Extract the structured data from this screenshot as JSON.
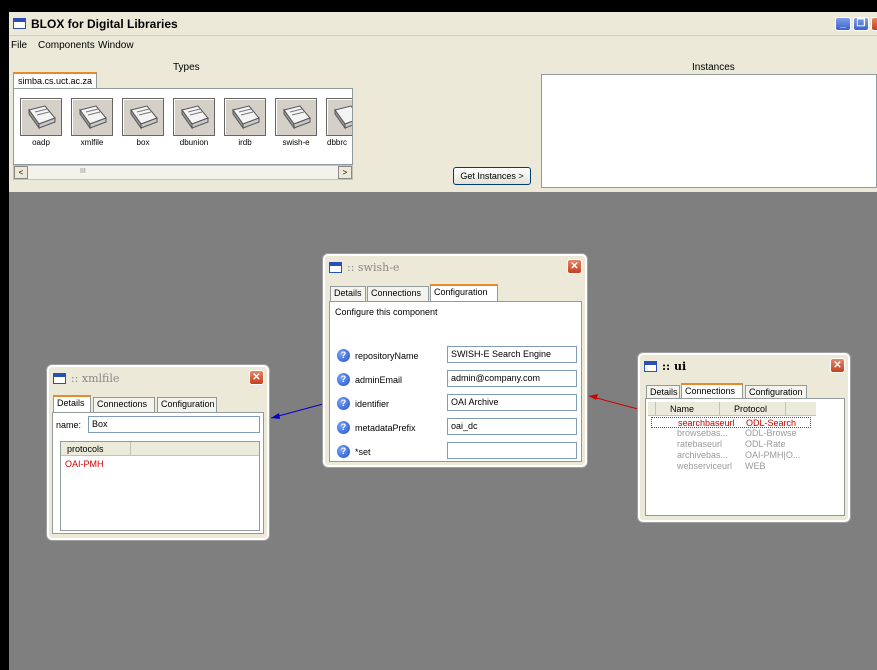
{
  "app": {
    "title": "BLOX for Digital Libraries",
    "minimize": "_",
    "restore": "❐",
    "close": "✕"
  },
  "menu": [
    "File",
    "Components",
    "Window"
  ],
  "types": {
    "heading": "Types",
    "tab": "simba.cs.uct.ac.za",
    "components": [
      "oadp",
      "xmlfile",
      "box",
      "dbunion",
      "irdb",
      "swish-e",
      "dbbrc"
    ],
    "scroll_left": "<",
    "scroll_right": ">",
    "scroll_grip": "III"
  },
  "get_instances": "Get Instances >",
  "instances": {
    "heading": "Instances"
  },
  "xmlfile_win": {
    "title": ":: xmlfile",
    "tabs": [
      "Details",
      "Connections",
      "Configuration"
    ],
    "name_label": "name:",
    "name_value": "Box",
    "column": "protocols",
    "rows": [
      "OAI-PMH"
    ]
  },
  "swishe_win": {
    "title": ":: swish-e",
    "tabs": [
      "Details",
      "Connections",
      "Configuration"
    ],
    "intro": "Configure this component",
    "help": "?",
    "fields": [
      {
        "label": "repositoryName",
        "value": "SWISH-E Search Engine"
      },
      {
        "label": "adminEmail",
        "value": "admin@company.com"
      },
      {
        "label": "identifier",
        "value": "OAI Archive"
      },
      {
        "label": "metadataPrefix",
        "value": "oai_dc"
      },
      {
        "label": "*set",
        "value": ""
      }
    ]
  },
  "ui_win": {
    "title": ":: ui",
    "tabs": [
      "Details",
      "Connections",
      "Configuration"
    ],
    "columns": [
      "Name",
      "Protocol"
    ],
    "rows": [
      {
        "name": "searchbaseurl",
        "protocol": "ODL-Search"
      },
      {
        "name": "browsebas...",
        "protocol": "ODL-Browse"
      },
      {
        "name": "ratebaseurl",
        "protocol": "ODL-Rate"
      },
      {
        "name": "archivebas...",
        "protocol": "OAI-PMH|O..."
      },
      {
        "name": "webserviceurl",
        "protocol": "WEB"
      }
    ]
  },
  "colors": {
    "accent_red": "#cc0000",
    "link_blue": "#0000cc",
    "canvas": "#7f7f7f",
    "inactive_text": "#9a9a9a"
  }
}
